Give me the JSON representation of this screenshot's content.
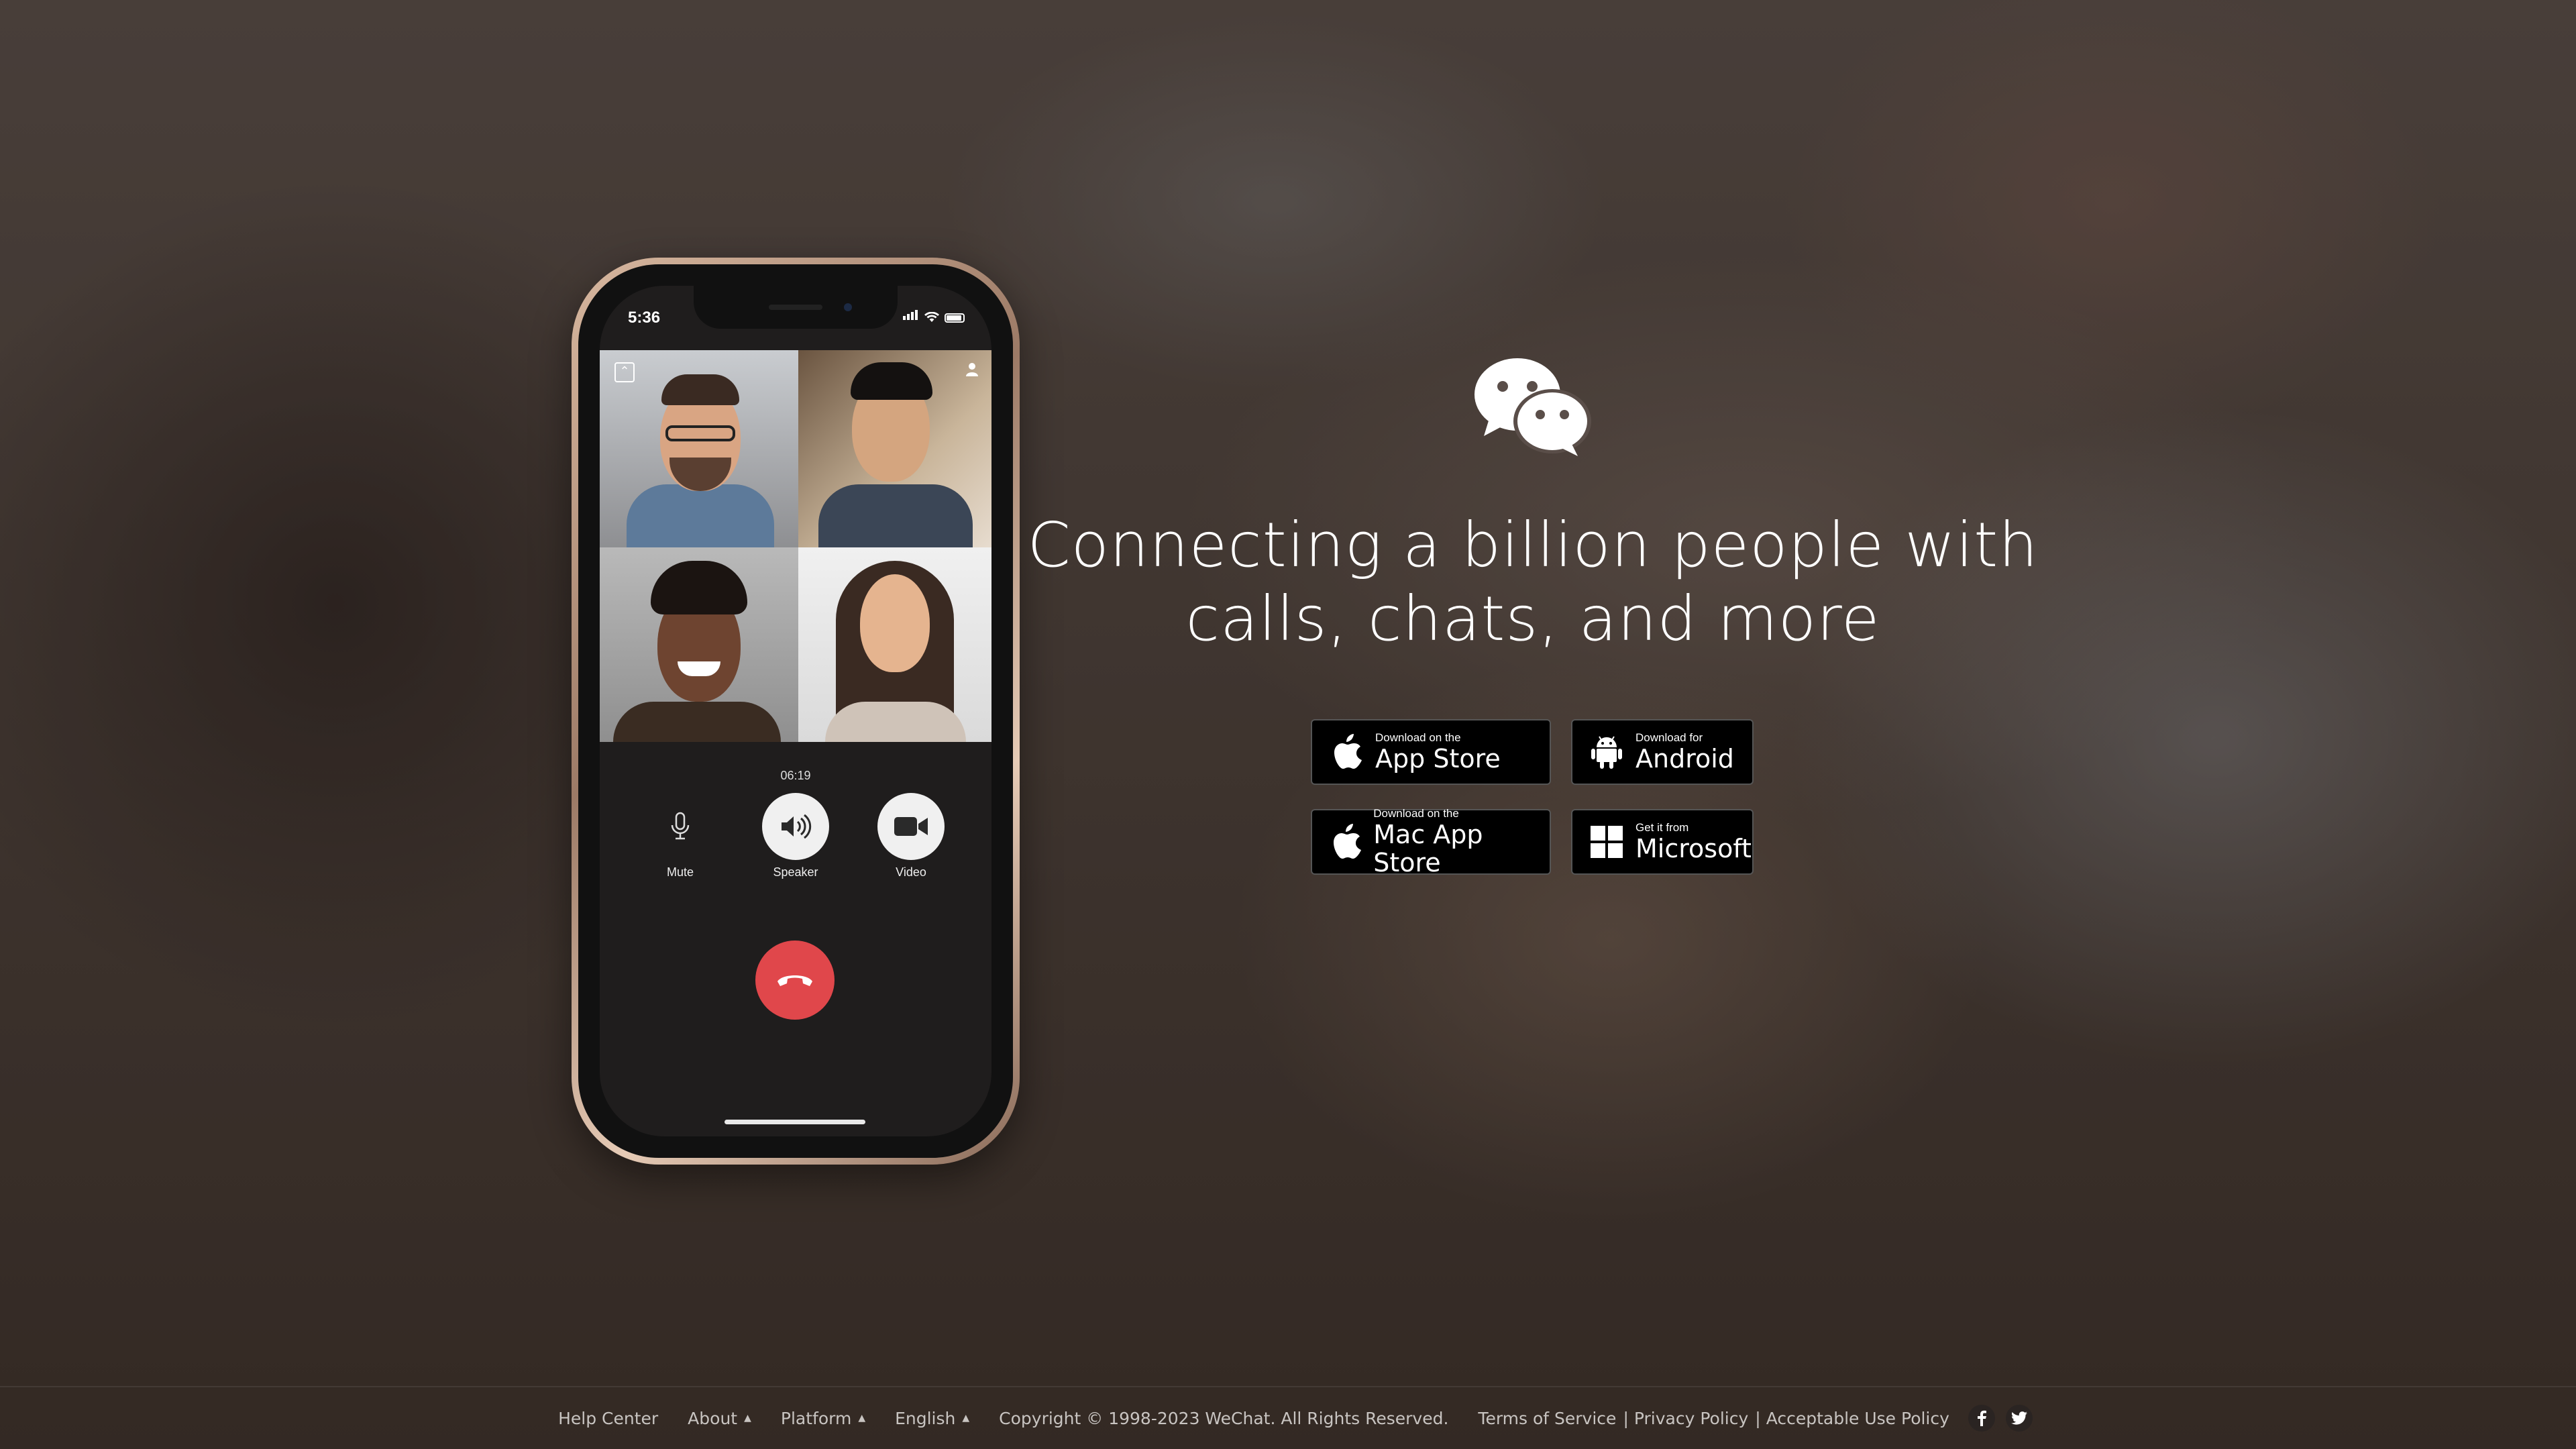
{
  "phone": {
    "time": "5:36",
    "call_timer": "06:19",
    "controls": [
      {
        "label": "Mute",
        "icon": "microphone-icon"
      },
      {
        "label": "Speaker",
        "icon": "speaker-icon"
      },
      {
        "label": "Video",
        "icon": "video-camera-icon"
      }
    ],
    "hangup_icon": "phone-hangup-icon"
  },
  "hero": {
    "headline": "Connecting a billion people with calls, chats, and more",
    "logo_icon": "wechat-logo-icon"
  },
  "downloads": [
    {
      "small": "Download on the",
      "big": "App Store",
      "icon": "apple-icon"
    },
    {
      "small": "Download for",
      "big": "Android",
      "icon": "android-icon"
    },
    {
      "small": "Download on the",
      "big": "Mac App Store",
      "icon": "apple-icon"
    },
    {
      "small": "Get it from",
      "big": "Microsoft",
      "icon": "windows-icon"
    }
  ],
  "footer": {
    "help_center": "Help Center",
    "about": "About",
    "platform": "Platform",
    "language": "English",
    "copyright": "Copyright © 1998-2023 WeChat. All Rights Reserved.",
    "terms": "Terms of Service",
    "privacy": "Privacy Policy",
    "acceptable_use": "Acceptable Use Policy",
    "separator": "|",
    "social": [
      "facebook-icon",
      "twitter-icon"
    ]
  },
  "colors": {
    "hangup": "#e0474b",
    "button_bg": "#000000",
    "text": "#ffffff"
  }
}
